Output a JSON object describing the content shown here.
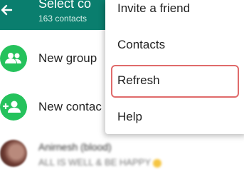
{
  "header": {
    "title": "Select co",
    "subtitle": "163 contacts",
    "back_icon": "arrow-back-icon",
    "background_color": "#0a7e6e"
  },
  "list": {
    "new_group_label": "New group",
    "new_group_icon": "group-icon",
    "new_contact_label": "New contac",
    "new_contact_icon": "add-person-icon",
    "contact": {
      "name": "Anirnesh (blood)",
      "status": "ALL IS WELL & BE HAPPY"
    },
    "accent_color": "#25c25c"
  },
  "menu": {
    "items": [
      {
        "label": "Invite a friend"
      },
      {
        "label": "Contacts"
      },
      {
        "label": "Refresh",
        "highlighted": true
      },
      {
        "label": "Help"
      }
    ],
    "highlight_color": "#e06b6b"
  }
}
